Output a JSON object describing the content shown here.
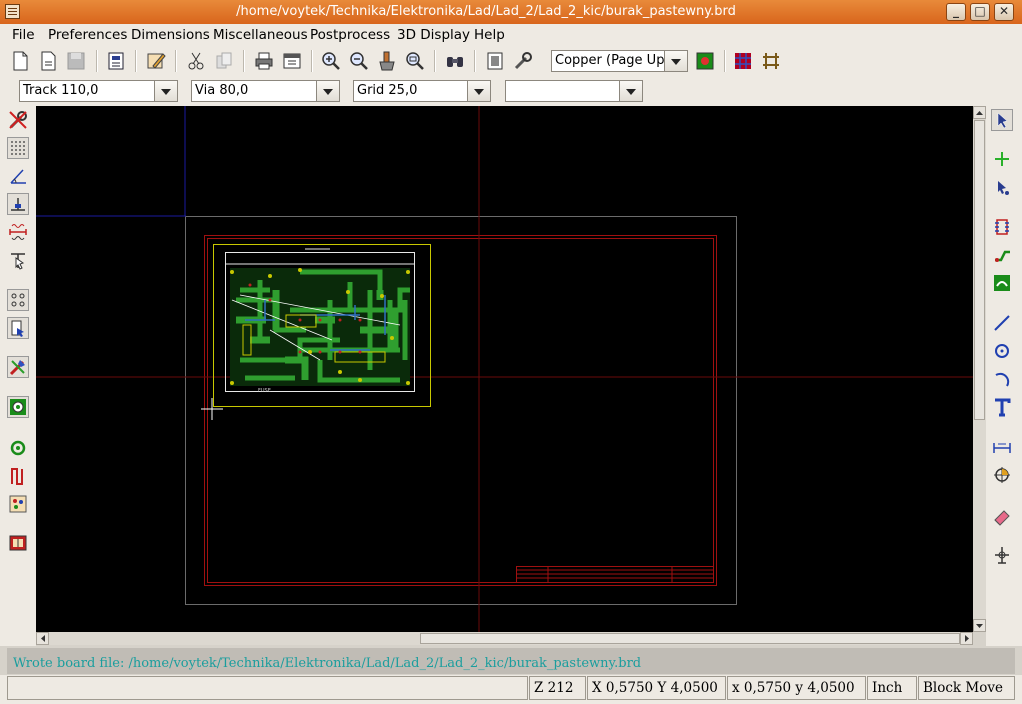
{
  "window": {
    "title": "/home/voytek/Technika/Elektronika/Lad/Lad_2/Lad_2_kic/burak_pastewny.brd",
    "buttons": {
      "minimize": "_",
      "maximize": "□",
      "close": "✕"
    }
  },
  "menu": [
    "File",
    "Preferences",
    "Dimensions",
    "Miscellaneous",
    "Postprocess",
    "3D Display",
    "Help"
  ],
  "toolbar": {
    "icons": [
      "new-board-icon",
      "open-board-icon",
      "save-icon",
      "page-settings-icon",
      "library-icon",
      "cut-icon",
      "copy-icon",
      "print-icon",
      "plot-icon",
      "zoom-in-icon",
      "zoom-out-icon",
      "redraw-icon",
      "zoom-auto-icon",
      "find-icon",
      "netlist-icon",
      "drc-icon",
      "layer-color-icon",
      "autoplace-icon",
      "autoroute-icon"
    ],
    "layer_select": "Copper    (Page Up)"
  },
  "optionsbar": {
    "track": "Track 110,0",
    "via": "Via 80,0",
    "grid": "Grid 25,0",
    "zoom": ""
  },
  "left_toolbar": [
    "drc-off-icon",
    "grid-toggle-icon",
    "polar-coord-icon",
    "units-toggle-icon",
    "inch-mm-icon",
    "cursor-shape-icon",
    "ratsnest-icon",
    "module-ratsnest-icon",
    "auto-delete-track-icon",
    "pads-sketch-icon",
    "via-sketch-icon",
    "tracks-sketch-icon",
    "high-contrast-icon",
    "microwave-toolbar-icon"
  ],
  "right_toolbar": [
    "select-arrow-icon",
    "add-component-icon",
    "net-highlight-icon",
    "local-ratsnest-icon",
    "add-module-icon",
    "add-track-icon",
    "add-zone-icon",
    "add-line-icon",
    "add-circle-icon",
    "add-arc-icon",
    "add-text-icon",
    "add-dimension-icon",
    "add-target-icon",
    "delete-icon",
    "set-origin-icon"
  ],
  "board": {
    "silk_label": "FUSE"
  },
  "status": {
    "message": "Wrote board file: /home/voytek/Technika/Elektronika/Lad/Lad_2/Lad_2_kic/burak_pastewny.brd",
    "zoom": "Z 212",
    "abs_coords": "X 0,5750  Y 4,0500",
    "rel_coords": "x 0,5750  y 4,0500",
    "units": "Inch",
    "mode": "Block Move"
  },
  "colors": {
    "titlebar": "#d8651c",
    "canvas": "#000000",
    "sheet_border": "#8b0000",
    "board_outline": "#c8c800",
    "track_green": "#2f9e2f",
    "message_text": "#1a9e9e"
  }
}
